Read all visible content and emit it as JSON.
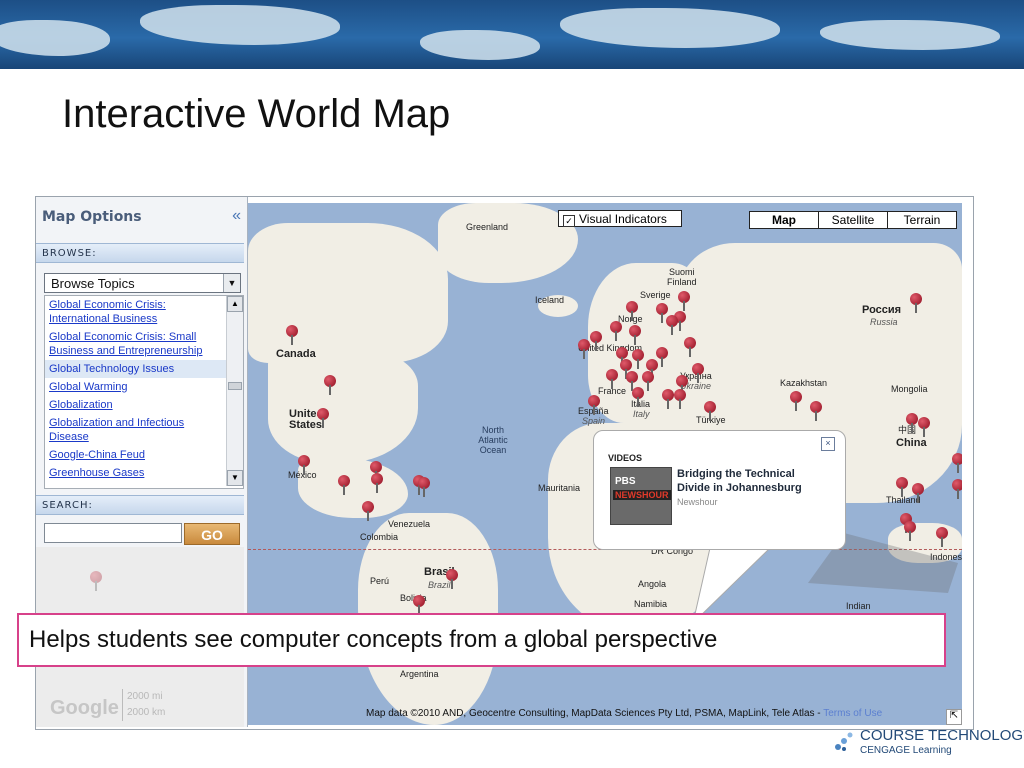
{
  "slide": {
    "title": "Interactive World Map",
    "callout": "Helps students see computer concepts from a global perspective"
  },
  "sidebar": {
    "header": "Map Options",
    "collapse_icon": "«",
    "browse_label": "BROWSE:",
    "select_value": "Browse Topics",
    "topics": [
      "Global Economic Crisis: International Business",
      "Global Economic Crisis: Small Business and Entrepreneurship",
      "Global Technology Issues",
      "Global Warming",
      "Globalization",
      "Globalization and Infectious Disease",
      "Google-China Feud",
      "Greenhouse Gases"
    ],
    "selected_topic_index": 2,
    "search_label": "SEARCH:",
    "search_value": "",
    "go_label": "GO",
    "google_logo": "Google",
    "scale": [
      "2000 mi",
      "2000 km"
    ]
  },
  "map": {
    "visual_indicators_label": "Visual Indicators",
    "visual_indicators_checked": true,
    "types": [
      "Map",
      "Satellite",
      "Terrain"
    ],
    "active_type": "Map",
    "labels": {
      "greenland": "Greenland",
      "iceland": "Iceland",
      "canada": "Canada",
      "us1": "United",
      "us2": "States",
      "mexico": "México",
      "venezuela": "Venezuela",
      "colombia": "Colombia",
      "peru": "Perú",
      "brasil": "Brasil",
      "brazil": "Brazil",
      "bolivia": "Bolivia",
      "argentina": "Argentina",
      "ocean1": "North",
      "ocean2": "Atlantic",
      "ocean3": "Ocean",
      "suomi": "Suomi",
      "finland": "Finland",
      "sverige": "Sverige",
      "norge": "Norge",
      "united_kingdom": "United Kingdom",
      "france": "France",
      "espana": "España",
      "spain": "Spain",
      "italia": "Italia",
      "italy": "Italy",
      "ukraina": "Україна",
      "ukraine": "Ukraine",
      "turkiye": "Türkiye",
      "rossiya": "Россия",
      "russia": "Russia",
      "kazakhstan": "Kazakhstan",
      "mongolia": "Mongolia",
      "china_zh": "中国",
      "china": "China",
      "thailand": "Thailand",
      "indonesia": "Indones",
      "mauritania": "Mauritania",
      "drcongo": "DR Congo",
      "angola": "Angola",
      "namibia": "Namibia",
      "indian": "Indian"
    },
    "popup": {
      "heading": "VIDEOS",
      "title": "Bridging the Technical Divide in Johannesburg",
      "source": "Newshour",
      "thumb_top": "PBS",
      "thumb_bottom": "NEWSHOUR",
      "close_icon": "×"
    },
    "credits": "Map data ©2010 AND, Geocentre Consulting, MapData Sciences Pty Ltd, PSMA, MapLink, Tele Atlas - ",
    "terms_link": "Terms of Use"
  },
  "branding": {
    "line1": "COURSE TECHNOLOGY",
    "line2": "CENGAGE Learning"
  },
  "colors": {
    "accent": "#d7418a",
    "pin": "#8e0d1e",
    "ocean": "#98b2d4",
    "land": "#f1eee5"
  }
}
